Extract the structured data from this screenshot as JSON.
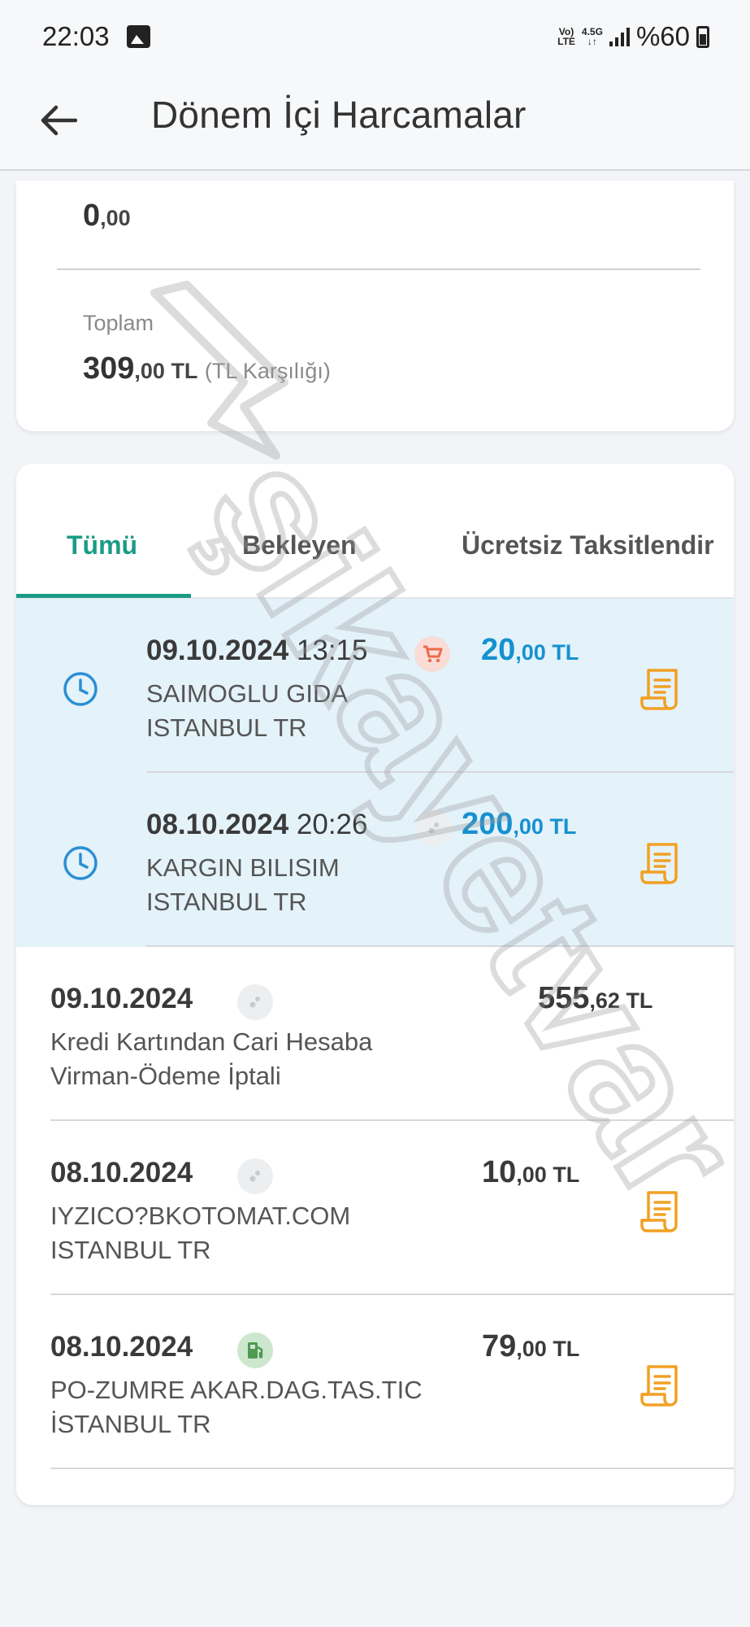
{
  "status_bar": {
    "time": "22:03",
    "network_top": "Vo)",
    "network_bottom": "LTE",
    "data_top": "4.5G",
    "data_bottom": "↓↑",
    "battery": "%60"
  },
  "app_bar": {
    "title": "Dönem İçi Harcamalar",
    "back_icon": "arrow-left-icon"
  },
  "summary": {
    "prev_amount_int": "0",
    "prev_amount_dec": ",00",
    "total_label": "Toplam",
    "total_int": "309",
    "total_dec": ",00 TL",
    "total_note": "(TL Karşılığı)"
  },
  "tabs": [
    {
      "label": "Tümü",
      "active": true
    },
    {
      "label": "Bekleyen",
      "active": false
    },
    {
      "label": "Ücretsiz Taksitlendir",
      "active": false
    }
  ],
  "transactions": [
    {
      "date": "09.10.2024",
      "time": "13:15",
      "merchant": "SAIMOGLU GIDA",
      "location": "ISTANBUL TR",
      "amount_int": "20",
      "amount_dec": ",00 TL",
      "category_icon": "shopping-cart-icon",
      "status": "pending",
      "has_receipt": true
    },
    {
      "date": "08.10.2024",
      "time": "20:26",
      "merchant": "KARGIN BILISIM",
      "location": "ISTANBUL TR",
      "amount_int": "200",
      "amount_dec": ",00 TL",
      "category_icon": "misc-category-icon",
      "status": "pending",
      "has_receipt": true
    },
    {
      "date": "09.10.2024",
      "time": "",
      "merchant": "Kredi Kartından Cari Hesaba",
      "location": "Virman-Ödeme İptali",
      "amount_int": "555",
      "amount_dec": ",62 TL",
      "category_icon": "misc-category-icon",
      "status": "posted",
      "has_receipt": false
    },
    {
      "date": "08.10.2024",
      "time": "",
      "merchant": "IYZICO?BKOTOMAT.COM",
      "location": "ISTANBUL TR",
      "amount_int": "10",
      "amount_dec": ",00 TL",
      "category_icon": "misc-category-icon",
      "status": "posted",
      "has_receipt": true
    },
    {
      "date": "08.10.2024",
      "time": "",
      "merchant": "PO-ZUMRE AKAR.DAG.TAS.TIC",
      "location": "İSTANBUL TR",
      "amount_int": "79",
      "amount_dec": ",00 TL",
      "category_icon": "fuel-pump-icon",
      "status": "posted",
      "has_receipt": true
    }
  ],
  "watermark": {
    "text": "şikayetvar"
  },
  "colors": {
    "accent": "#1a9c86",
    "pending_bg": "#e4f2fa",
    "pending_amount": "#1591d0",
    "receipt_icon": "#f2a024",
    "clock_icon": "#2a8fd4"
  }
}
